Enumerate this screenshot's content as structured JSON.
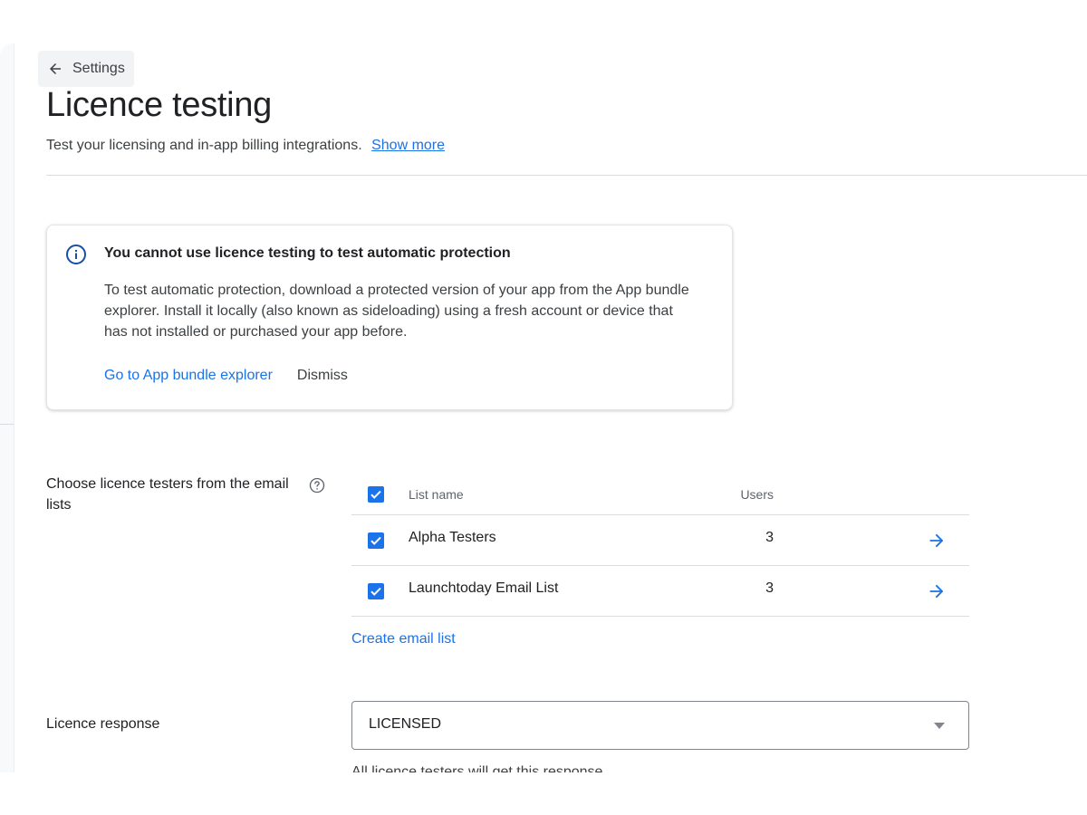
{
  "nav": {
    "back_label": "Settings"
  },
  "header": {
    "title": "Licence testing",
    "subtitle": "Test your licensing and in-app billing integrations.",
    "show_more": "Show more"
  },
  "info_card": {
    "title": "You cannot use licence testing to test automatic protection",
    "body": "To test automatic protection, download a protected version of your app from the App bundle explorer. Install it locally (also known as sideloading) using a fresh account or device that has not installed or purchased your app before.",
    "primary_action": "Go to App bundle explorer",
    "secondary_action": "Dismiss"
  },
  "testers": {
    "label": "Choose licence testers from the email lists",
    "columns": {
      "name": "List name",
      "users": "Users"
    },
    "rows": [
      {
        "name": "Alpha Testers",
        "users": "3",
        "checked": true
      },
      {
        "name": "Launchtoday Email List",
        "users": "3",
        "checked": true
      }
    ],
    "create_link": "Create email list"
  },
  "licence_response": {
    "label": "Licence response",
    "value": "LICENSED",
    "helper": "All licence testers will get this response"
  },
  "colors": {
    "accent": "#1a73e8",
    "info_icon": "#174ea6",
    "text_primary": "#202124",
    "text_secondary": "#3c4043"
  },
  "icons": {
    "back": "arrow-left-icon",
    "info": "info-icon",
    "help": "help-icon",
    "row_open": "arrow-right-icon",
    "dropdown": "caret-down-icon",
    "checkbox": "checkmark-icon"
  }
}
